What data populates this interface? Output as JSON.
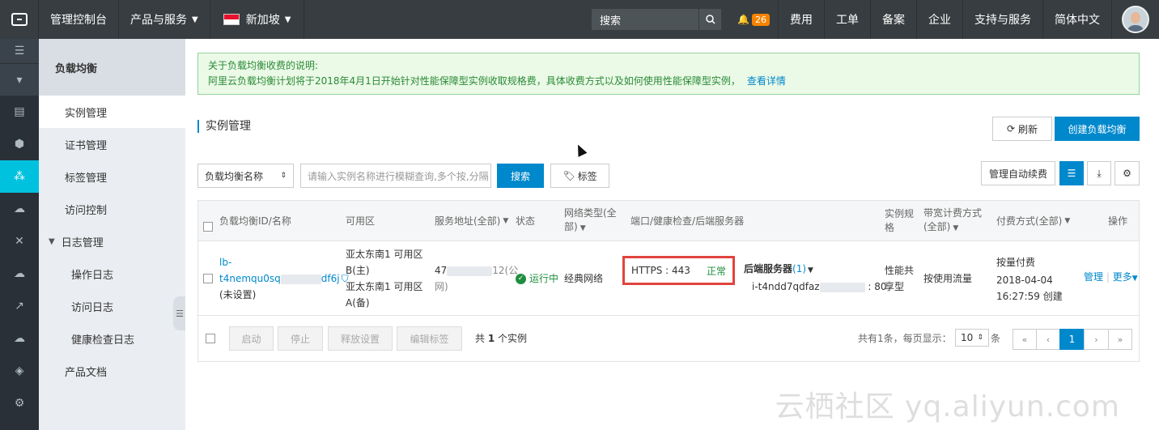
{
  "topbar": {
    "console": "管理控制台",
    "products": "产品与服务",
    "region": "新加坡",
    "search_placeholder": "搜索",
    "notif_count": "26",
    "links": [
      "费用",
      "工单",
      "备案",
      "企业",
      "支持与服务",
      "简体中文"
    ]
  },
  "subnav": {
    "title": "负载均衡",
    "items": [
      "实例管理",
      "证书管理",
      "标签管理",
      "访问控制"
    ],
    "log_group": "日志管理",
    "log_items": [
      "操作日志",
      "访问日志",
      "健康检查日志"
    ],
    "docs": "产品文档"
  },
  "notice": {
    "line1": "关于负载均衡收费的说明:",
    "line2": "阿里云负载均衡计划将于2018年4月1日开始针对性能保障型实例收取规格费，具体收费方式以及如何使用性能保障型实例，",
    "link": "查看详情"
  },
  "page": {
    "title": "实例管理",
    "refresh": "刷新",
    "create": "创建负载均衡",
    "filter_select": "负载均衡名称",
    "search_placeholder": "请输入实例名称进行模糊查询,多个按,分隔",
    "search_btn": "搜索",
    "tag_btn": "标签",
    "auto_renew": "管理自动续费"
  },
  "table": {
    "headers": {
      "id": "负载均衡ID/名称",
      "zone": "可用区",
      "address": "服务地址(全部)",
      "status": "状态",
      "net1": "网络类型(全",
      "net2": "部)",
      "port": "端口/健康检查/后端服务器",
      "spec1": "实例规",
      "spec2": "格",
      "bw1": "带宽计费方式",
      "bw2": "(全部)",
      "pay": "付费方式(全部)",
      "ops": "操作"
    },
    "row": {
      "id1": "lb-",
      "id2": "t4nemqu0sq",
      "id3": "df6j",
      "name": "(未设置)",
      "zone1a": "亚太东南1 可用区",
      "zone1b": "B(主)",
      "zone2a": "亚太东南1 可用区",
      "zone2b": "A(备)",
      "addr_a": "47",
      "addr_b": "12(公",
      "addr_c": "网)",
      "status": "运行中",
      "net": "经典网络",
      "port": "HTTPS : 443",
      "health": "正常",
      "backend_label": "后端服务器",
      "backend_count": "(1)",
      "backend_id": "i-t4ndd7qdfaz",
      "backend_port": ": 80",
      "spec1": "性能共",
      "spec2": "享型",
      "bw": "按使用流量",
      "pay": "按量付费",
      "date1": "2018-04-04",
      "date2": "16:27:59 创建",
      "manage": "管理",
      "more": "更多"
    },
    "footer": {
      "start": "启动",
      "stop": "停止",
      "release": "释放设置",
      "edit_tags": "编辑标签",
      "total_prefix": "共",
      "total_count": "1",
      "total_suffix": "个实例",
      "summary": "共有1条，每页显示：",
      "page_size": "10",
      "page_size_suffix": "条",
      "pages": [
        "«",
        "‹",
        "1",
        "›",
        "»"
      ]
    }
  },
  "watermark": "云栖社区 yq.aliyun.com"
}
